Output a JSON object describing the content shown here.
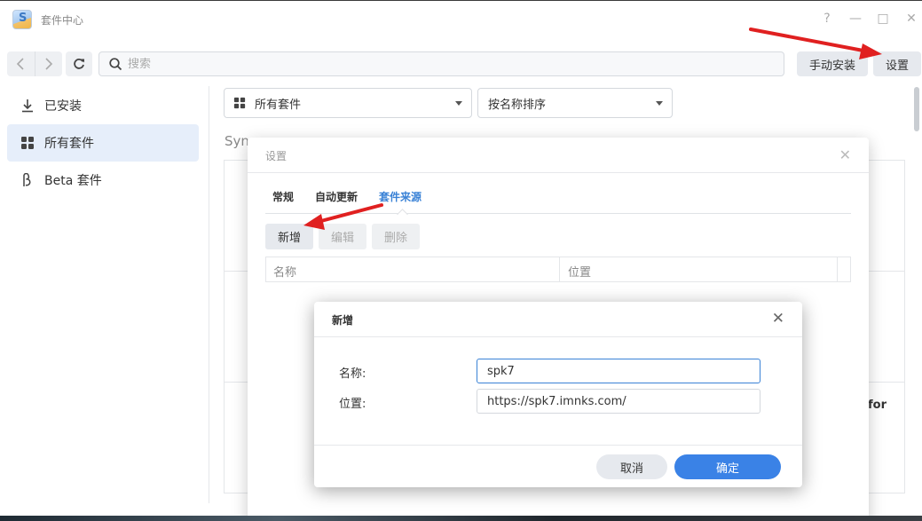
{
  "window": {
    "title": "套件中心"
  },
  "controls": {
    "help": "?",
    "minimize": "—",
    "maximize": "□",
    "close": "✕"
  },
  "toolbar": {
    "search_placeholder": "搜索",
    "manual_install_label": "手动安装",
    "settings_label": "设置"
  },
  "sidebar": {
    "items": [
      {
        "label": "已安装",
        "icon": "download-icon"
      },
      {
        "label": "所有套件",
        "icon": "grid-icon"
      },
      {
        "label": "Beta 套件",
        "icon": "beta-icon"
      }
    ]
  },
  "main": {
    "filter_value": "所有套件",
    "sort_value": "按名称排序",
    "section_label_partial": "Syn",
    "partial_text": "for"
  },
  "settings_dialog": {
    "title": "设置",
    "tabs": [
      {
        "label": "常规"
      },
      {
        "label": "自动更新"
      },
      {
        "label": "套件来源"
      }
    ],
    "buttons": {
      "add": "新增",
      "edit": "编辑",
      "delete": "删除"
    },
    "columns": {
      "name": "名称",
      "location": "位置"
    }
  },
  "add_dialog": {
    "title": "新增",
    "name_label": "名称:",
    "name_value": "spk7",
    "location_label": "位置:",
    "location_value": "https://spk7.imnks.com/",
    "cancel_label": "取消",
    "ok_label": "确定"
  },
  "colors": {
    "accent": "#3a82e6",
    "active_tab": "#3a82d6",
    "annotation_arrow": "#e02020",
    "sidebar_active_bg": "#e6eefa"
  }
}
